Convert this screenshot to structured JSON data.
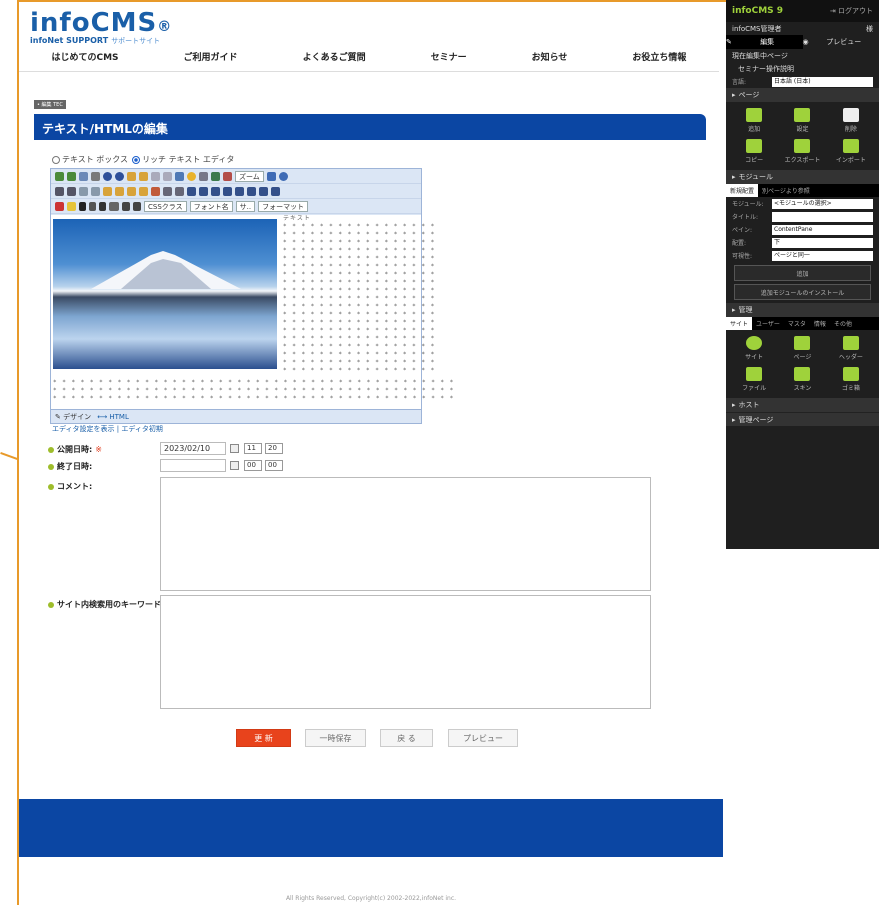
{
  "brand": {
    "logo": "infoCMS",
    "logo_mark": "®",
    "sub": "infoNet SUPPORT",
    "sub_small": "サポートサイト"
  },
  "nav": [
    "はじめてのCMS",
    "ご利用ガイド",
    "よくあるご質問",
    "セミナー",
    "お知らせ",
    "お役立ち情報"
  ],
  "breadcrumb": "• 編集 TEC",
  "page_title": "テキスト/HTMLの編集",
  "editor": {
    "mode_text": "テキスト ボックス",
    "mode_rich": "リッチ テキスト エディタ",
    "dropdown_zoom": "ズーム",
    "dropdown_css": "CSSクラス",
    "dropdown_font": "フォント名",
    "dropdown_size": "サ..",
    "dropdown_format": "フォーマット",
    "content_heading": "テキスト",
    "tab_design": "デザイン",
    "tab_html": "HTML",
    "link_show_settings": "エディタ設定を表示",
    "link_reset": "エディタ初期"
  },
  "form": {
    "start_label": "公開日時:",
    "start_req": "※",
    "start_date": "2023/02/10",
    "start_hour": "11",
    "start_min": "20",
    "end_label": "終了日時:",
    "end_date": "",
    "end_hour": "00",
    "end_min": "00",
    "comment_label": "コメント:",
    "keyword_label": "サイト内検索用のキーワード:"
  },
  "buttons": {
    "update": "更 新",
    "save_temp": "一時保存",
    "back": "戻 る",
    "preview": "プレビュー"
  },
  "copyright": "All Rights Reserved, Copyright(c) 2002-2022,infoNet inc.",
  "panel": {
    "logo": "infoCMS 9",
    "logout": "ログアウト",
    "user": "infoCMS管理者",
    "user_badge": "様",
    "mode_edit": "編集",
    "mode_preview": "プレビュー",
    "current_page_label": "現在編集中ページ",
    "current_page": "セミナー操作説明",
    "lang_label": "言語:",
    "lang_value": "日本語 (日本)",
    "sec_page": "ページ",
    "page_tools": [
      "追加",
      "設定",
      "削除",
      "コピー",
      "エクスポート",
      "インポート"
    ],
    "sec_module": "モジュール",
    "module_tabs": [
      "新規配置",
      "別ページより参照"
    ],
    "module_fields": [
      {
        "label": "モジュール:",
        "value": "<モジュールの選択>"
      },
      {
        "label": "タイトル:",
        "value": ""
      },
      {
        "label": "ペイン:",
        "value": "ContentPane"
      },
      {
        "label": "配置:",
        "value": "下"
      },
      {
        "label": "可視性:",
        "value": "ページと同一"
      }
    ],
    "btn_add": "追加",
    "btn_install": "追加モジュールのインストール",
    "sec_admin": "管理",
    "admin_tabs": [
      "サイト",
      "ユーザー",
      "マスタ",
      "情報",
      "その他"
    ],
    "admin_tools": [
      "サイト",
      "ページ",
      "ヘッダー",
      "ファイル",
      "スキン",
      "ゴミ箱"
    ],
    "sec_host": "ホスト",
    "sec_admin_page": "管理ページ",
    "colors": {
      "accent": "#9fd23b",
      "page_accent": "#0b46a3",
      "button_red": "#e8431c"
    }
  }
}
